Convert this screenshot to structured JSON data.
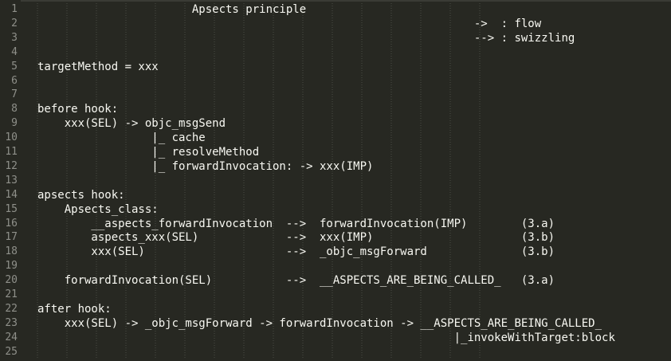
{
  "editor": {
    "colors": {
      "background": "#272822",
      "text": "#f8f8f2",
      "line_numbers": "#8f908a",
      "indent_guides": "#4a4b44"
    },
    "lines": [
      {
        "number": "1",
        "text": "                       Apsects principle"
      },
      {
        "number": "2",
        "text": "                                                                 ->  : flow"
      },
      {
        "number": "3",
        "text": "                                                                 --> : swizzling"
      },
      {
        "number": "4",
        "text": ""
      },
      {
        "number": "5",
        "text": "targetMethod = xxx"
      },
      {
        "number": "6",
        "text": ""
      },
      {
        "number": "7",
        "text": ""
      },
      {
        "number": "8",
        "text": "before hook:"
      },
      {
        "number": "9",
        "text": "    xxx(SEL) -> objc_msgSend"
      },
      {
        "number": "10",
        "text": "                 |_ cache"
      },
      {
        "number": "11",
        "text": "                 |_ resolveMethod"
      },
      {
        "number": "12",
        "text": "                 |_ forwardInvocation: -> xxx(IMP)"
      },
      {
        "number": "13",
        "text": ""
      },
      {
        "number": "14",
        "text": "apsects hook:"
      },
      {
        "number": "15",
        "text": "    Apsects_class:"
      },
      {
        "number": "16",
        "text": "        __aspects_forwardInvocation  -->  forwardInvocation(IMP)        (3.a)"
      },
      {
        "number": "17",
        "text": "        aspects_xxx(SEL)             -->  xxx(IMP)                      (3.b)"
      },
      {
        "number": "18",
        "text": "        xxx(SEL)                     -->  _objc_msgForward              (3.b)"
      },
      {
        "number": "19",
        "text": ""
      },
      {
        "number": "20",
        "text": "    forwardInvocation(SEL)           -->  __ASPECTS_ARE_BEING_CALLED_   (3.a)"
      },
      {
        "number": "21",
        "text": ""
      },
      {
        "number": "22",
        "text": "after hook:"
      },
      {
        "number": "23",
        "text": "    xxx(SEL) -> _objc_msgForward -> forwardInvocation -> __ASPECTS_ARE_BEING_CALLED_"
      },
      {
        "number": "24",
        "text": "                                                              |_invokeWithTarget:block"
      },
      {
        "number": "25",
        "text": ""
      }
    ]
  }
}
